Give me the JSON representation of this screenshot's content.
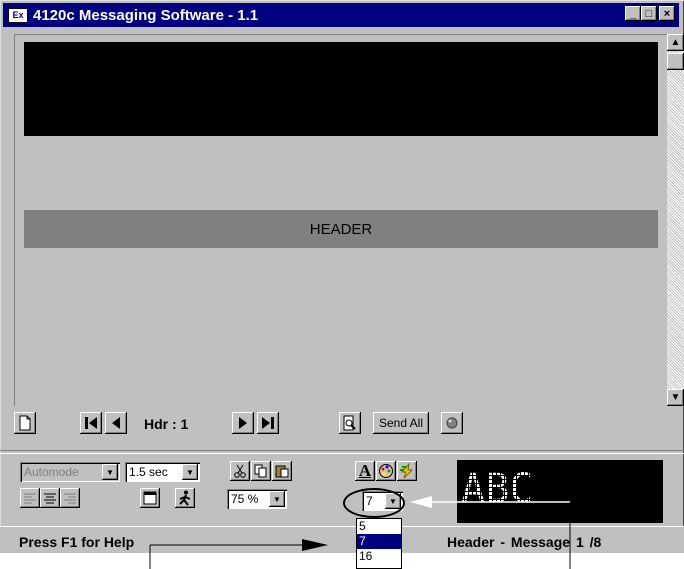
{
  "window": {
    "app_icon_text": "Ex",
    "title": "4120c  Messaging Software - 1.1",
    "minimize_glyph": "_",
    "maximize_glyph": "□",
    "close_glyph": "×"
  },
  "canvas": {
    "header_label": "HEADER"
  },
  "scrollbar": {
    "up_glyph": "▲",
    "down_glyph": "▼"
  },
  "nav": {
    "header_label": "Hdr : 1",
    "send_all_label": "Send All"
  },
  "toolbar": {
    "mode_value": "Automode",
    "speed_value": "1.5 sec",
    "zoom_value": "75 %",
    "font_size_value": "7",
    "preview_text": "ABC",
    "font_button_glyph": "A"
  },
  "font_size_dropdown": {
    "options": [
      "5",
      "7",
      "16"
    ],
    "selected_index": 1
  },
  "status": {
    "help_text": "Press F1 for Help",
    "message_text": "Header  - Message 1  /8"
  },
  "colors": {
    "title_bar": "#000080",
    "window_face": "#c0c0c0",
    "header_band": "#808080",
    "selection": "#000080"
  }
}
